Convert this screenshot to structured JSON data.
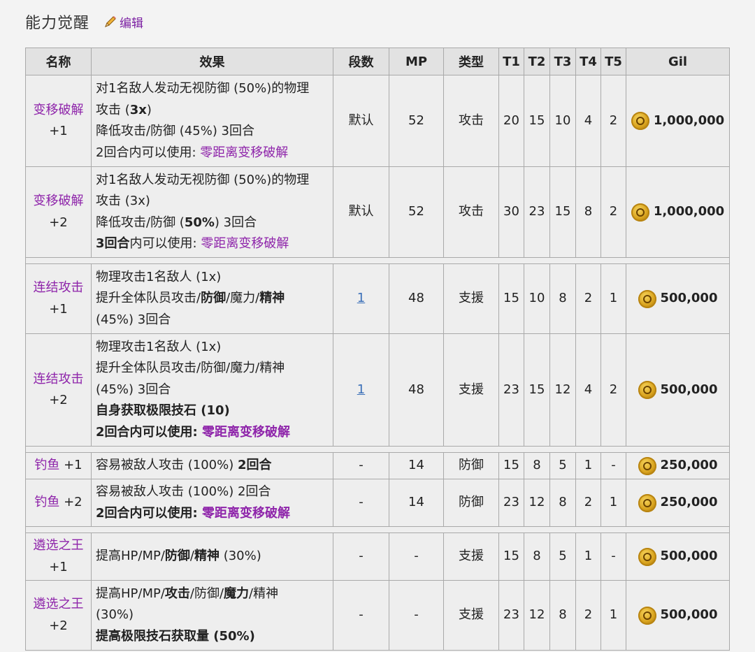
{
  "header": {
    "title": "能力觉醒",
    "edit_label": "编辑"
  },
  "columns": [
    "名称",
    "效果",
    "段数",
    "MP",
    "类型",
    "T1",
    "T2",
    "T3",
    "T4",
    "T5",
    "Gil"
  ],
  "rows": [
    {
      "name": "变移破解",
      "level": "+1",
      "effect": [
        [
          "对1名敌人发动无视防御 (50%)的物理"
        ],
        [
          "攻击 (",
          {
            "b": "3x"
          },
          ")"
        ],
        [
          "降低攻击/防御 (45%) 3回合"
        ],
        [
          "2回合内可以使用: ",
          {
            "l": "零距离变移破解"
          }
        ]
      ],
      "hits": "默认",
      "mp": "52",
      "type": "攻击",
      "t1": "20",
      "t2": "15",
      "t3": "10",
      "t4": "4",
      "t5": "2",
      "gil": "1,000,000"
    },
    {
      "name": "变移破解",
      "level": "+2",
      "effect": [
        [
          "对1名敌人发动无视防御 (50%)的物理"
        ],
        [
          "攻击 (3x)"
        ],
        [
          "降低攻击/防御 (",
          {
            "b": "50%"
          },
          ") 3回合"
        ],
        [
          {
            "b": "3回合"
          },
          "内可以使用: ",
          {
            "l": "零距离变移破解"
          }
        ]
      ],
      "hits": "默认",
      "mp": "52",
      "type": "攻击",
      "t1": "30",
      "t2": "23",
      "t3": "15",
      "t4": "8",
      "t5": "2",
      "gil": "1,000,000"
    },
    {
      "sep": true
    },
    {
      "name": "连结攻击",
      "level": "+1",
      "effect": [
        [
          "物理攻击1名敌人 (1x)"
        ],
        [
          "提升全体队员攻击/",
          {
            "b": "防御"
          },
          "/魔力/",
          {
            "b": "精神"
          }
        ],
        [
          "(45%) 3回合"
        ]
      ],
      "hits": "1",
      "hits_link": true,
      "mp": "48",
      "type": "支援",
      "t1": "15",
      "t2": "10",
      "t3": "8",
      "t4": "2",
      "t5": "1",
      "gil": "500,000"
    },
    {
      "name": "连结攻击",
      "level": "+2",
      "effect": [
        [
          "物理攻击1名敌人 (1x)"
        ],
        [
          "提升全体队员攻击/防御/魔力/精神"
        ],
        [
          "(45%) 3回合"
        ],
        [
          {
            "b": "自身获取极限技石 (10)"
          }
        ],
        [
          {
            "b": "2回合内可以使用: "
          },
          {
            "bl": "零距离变移破解"
          }
        ]
      ],
      "hits": "1",
      "hits_link": true,
      "mp": "48",
      "type": "支援",
      "t1": "23",
      "t2": "15",
      "t3": "12",
      "t4": "4",
      "t5": "2",
      "gil": "500,000"
    },
    {
      "sep": true
    },
    {
      "name": "钓鱼",
      "level": "+1",
      "inline": true,
      "effect": [
        [
          "容易被敌人攻击 (100%) ",
          {
            "b": "2回合"
          }
        ]
      ],
      "hits": "-",
      "mp": "14",
      "type": "防御",
      "t1": "15",
      "t2": "8",
      "t3": "5",
      "t4": "1",
      "t5": "-",
      "gil": "250,000"
    },
    {
      "name": "钓鱼",
      "level": "+2",
      "inline": true,
      "effect": [
        [
          "容易被敌人攻击 (100%) 2回合"
        ],
        [
          {
            "b": "2回合内可以使用: "
          },
          {
            "bl": "零距离变移破解"
          }
        ]
      ],
      "hits": "-",
      "mp": "14",
      "type": "防御",
      "t1": "23",
      "t2": "12",
      "t3": "8",
      "t4": "2",
      "t5": "1",
      "gil": "250,000"
    },
    {
      "sep": true
    },
    {
      "name": "遴选之王",
      "level": "+1",
      "effect": [
        [
          "提高HP/MP/",
          {
            "b": "防御"
          },
          "/",
          {
            "b": "精神"
          },
          " (30%)"
        ]
      ],
      "hits": "-",
      "mp": "-",
      "type": "支援",
      "t1": "15",
      "t2": "8",
      "t3": "5",
      "t4": "1",
      "t5": "-",
      "gil": "500,000"
    },
    {
      "name": "遴选之王",
      "level": "+2",
      "effect": [
        [
          "提高HP/MP/",
          {
            "b": "攻击"
          },
          "/防御/",
          {
            "b": "魔力"
          },
          "/精神"
        ],
        [
          "(30%)"
        ],
        [
          {
            "b": "提高极限技石获取量 (50%)"
          }
        ]
      ],
      "hits": "-",
      "mp": "-",
      "type": "支援",
      "t1": "23",
      "t2": "12",
      "t3": "8",
      "t4": "2",
      "t5": "1",
      "gil": "500,000"
    }
  ],
  "colors": {
    "link": "#8e24aa",
    "blue_link": "#3a6fb8",
    "header_bg": "#e2e2e2",
    "cell_bg": "#eeeeee"
  }
}
